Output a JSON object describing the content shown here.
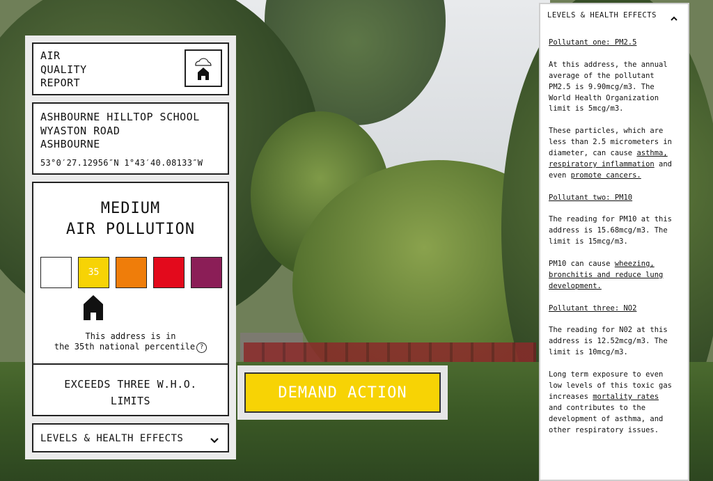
{
  "report": {
    "title_lines": [
      "AIR",
      "QUALITY",
      "REPORT"
    ],
    "logo_icon": "cloud-house-icon"
  },
  "location": {
    "address_lines": [
      "ASHBOURNE HILLTOP SCHOOL",
      "WYASTON ROAD",
      "ASHBOURNE"
    ],
    "coordinates": "53°0′27.12956″N 1°43′40.08133″W"
  },
  "pollution": {
    "level_lines": [
      "MEDIUM",
      "AIR POLLUTION"
    ],
    "scale": [
      {
        "color": "#ffffff",
        "label": ""
      },
      {
        "color": "#f7d305",
        "label": "35"
      },
      {
        "color": "#ef7d0a",
        "label": ""
      },
      {
        "color": "#e30a1c",
        "label": ""
      },
      {
        "color": "#8b1e57",
        "label": ""
      }
    ],
    "selected_index": 1,
    "percentile_lines": [
      "This address is in",
      "the 35th national percentile"
    ],
    "help_icon": "question-circle-icon"
  },
  "limits": {
    "text_lines": [
      "EXCEEDS THREE W.H.O.",
      "LIMITS"
    ]
  },
  "levels_toggle": {
    "label": "LEVELS & HEALTH EFFECTS",
    "icon": "chevron-down-icon"
  },
  "action": {
    "label": "DEMAND ACTION",
    "color": "#f7d305"
  },
  "health_panel": {
    "header": "LEVELS & HEALTH EFFECTS",
    "header_icon": "chevron-up-icon",
    "pm25_heading": "Pollutant one: PM2.5",
    "pm25_text": "At this address, the annual average of the pollutant PM2.5 is 9.90mcg/m3. The World Health Organization limit is 5mcg/m3.",
    "pm25_effect_prefix": "These particles, which are less than 2.5 micrometers in diameter, can cause ",
    "pm25_link1": "asthma, respiratory inflammation",
    "pm25_effect_mid": " and even ",
    "pm25_link2": "promote cancers.",
    "pm10_heading": "Pollutant two: PM10",
    "pm10_text": "The reading for PM10 at this address is 15.68mcg/m3. The limit is 15mcg/m3.",
    "pm10_effect_prefix": "PM10 can cause ",
    "pm10_link": "wheezing, bronchitis and reduce lung development.",
    "no2_heading": "Pollutant three: NO2",
    "no2_text": "The reading for N02 at this address is 12.52mcg/m3. The limit is 10mcg/m3.",
    "no2_effect_prefix": "Long term exposure to even low levels of this toxic gas increases ",
    "no2_link": "mortality rates",
    "no2_effect_suffix": " and contributes to the development of asthma, and other respiratory issues."
  }
}
